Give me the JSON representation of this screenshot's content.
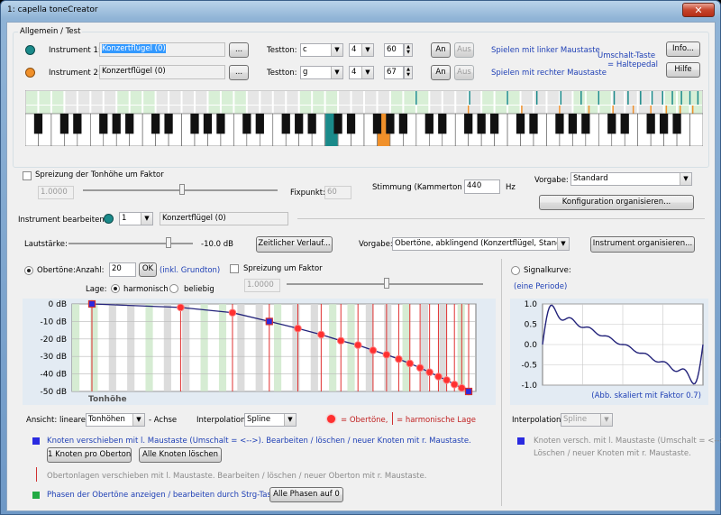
{
  "window": {
    "title": "1: capella toneCreator",
    "close": "✕"
  },
  "general": {
    "group_label": "Allgemein / Test",
    "instrument1_label": "Instrument 1:",
    "instrument1_value": "Konzertflügel (0)",
    "instrument2_label": "Instrument 2:",
    "instrument2_value": "Konzertflügel (0)",
    "browse_label": "...",
    "testton_label": "Testton:",
    "testton1": {
      "note": "c",
      "octave": "4",
      "number": "60"
    },
    "testton2": {
      "note": "g",
      "octave": "4",
      "number": "67"
    },
    "an_label": "An",
    "aus_label": "Aus",
    "hint_left": "Spielen mit linker Maustaste",
    "hint_right": "Spielen mit rechter Maustaste",
    "hint_shift_1": "Umschalt-Taste",
    "hint_shift_2": "= Haltepedal",
    "info_label": "Info...",
    "help_label": "Hilfe",
    "colors": {
      "instrument1": "#1a8a8a",
      "instrument2": "#f0902a"
    }
  },
  "spread": {
    "checkbox_label": "Spreizung der Tonhöhe um Faktor",
    "factor": "1.0000",
    "fixpoint_label": "Fixpunkt:",
    "fixpoint": "60"
  },
  "tuning": {
    "label": "Stimmung (Kammerton a):",
    "value": "440",
    "unit": "Hz"
  },
  "preset": {
    "label": "Vorgabe:",
    "value": "Standard",
    "config_button": "Konfiguration organisieren..."
  },
  "edit": {
    "label": "Instrument bearbeiten:",
    "number": "1",
    "name": "Konzertflügel (0)"
  },
  "volume": {
    "label": "Lautstärke:",
    "value": "-10.0 dB",
    "timeline_button": "Zeitlicher Verlauf...",
    "preset_label": "Vorgabe:",
    "preset_value": "Obertöne, abklingend (Konzertflügel, Standard)",
    "instrument_button": "Instrument organisieren..."
  },
  "overtones": {
    "radio_label": "Obertöne:",
    "count_label": "Anzahl:",
    "count": "20",
    "ok_label": "OK",
    "incl_note": "(inkl. Grundton)",
    "spread_label": "Spreizung um Faktor",
    "spread_factor": "1.0000",
    "lage_label": "Lage:",
    "harmonic_label": "harmonisch",
    "arbitrary_label": "beliebig",
    "y_ticks": [
      "0 dB",
      "-10 dB",
      "-20 dB",
      "-30 dB",
      "-40 dB",
      "-50 dB"
    ],
    "x_label": "Tonhöhe",
    "view_label": "Ansicht: lineare",
    "view_value": "Tonhöhen",
    "axis_label": "- Achse",
    "interp_label": "Interpolation:",
    "interp_value": "Spline",
    "legend_overtones": "= Obertöne,",
    "legend_harmonic": "= harmonische Lage",
    "info_knots_1": "Knoten verschieben mit l. Maustaste (Umschalt = <-->).   Bearbeiten / löschen / neuer Knoten mit r. Maustaste.",
    "knot_per_overtone": "1 Knoten pro Oberton",
    "delete_all_knots": "Alle Knoten löschen",
    "info_overtones": "Obertonlagen verschieben mit l. Maustaste.   Bearbeiten / löschen / neuer Oberton mit r. Maustaste.",
    "info_phases": "Phasen der Obertöne anzeigen / bearbeiten durch Strg-Taste",
    "all_phases_zero": "Alle Phasen auf 0",
    "curve": [
      0,
      -2,
      -5,
      -10,
      -14,
      -17.5,
      -21,
      -23.5,
      -26.5,
      -29,
      -31.5,
      -34,
      -36.5,
      -39,
      -41.5,
      -43.5,
      -46,
      -48,
      -50
    ],
    "knots": [
      0,
      -10,
      -50
    ]
  },
  "signal": {
    "radio_label": "Signalkurve:",
    "period_note": "(eine Periode)",
    "y_ticks": [
      "1.0",
      "0.5",
      "0.0",
      "-0.5",
      "-1.0"
    ],
    "scale_note": "(Abb. skaliert mit Faktor 0.7)",
    "interp_label": "Interpolation:",
    "interp_value": "Spline",
    "info_1": "Knoten versch. mit l. Maustaste (Umschalt = <-->).",
    "info_2": "Löschen / neuer Knoten mit r. Maustaste."
  }
}
